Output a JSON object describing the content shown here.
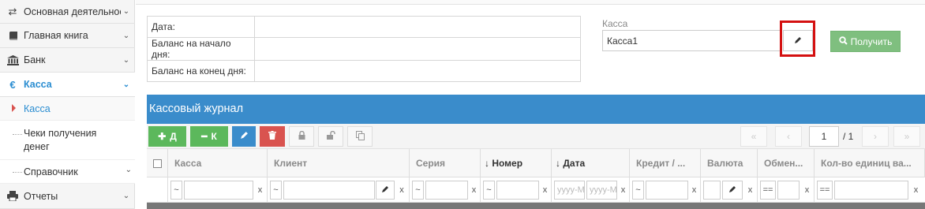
{
  "sidebar": {
    "items": [
      {
        "label": "Основная деятельность",
        "icon": "exchange-icon"
      },
      {
        "label": "Главная книга",
        "icon": "book-icon"
      },
      {
        "label": "Банк",
        "icon": "bank-icon"
      },
      {
        "label": "Касса",
        "icon": "euro-icon"
      },
      {
        "label": "Отчеты",
        "icon": "print-icon"
      }
    ],
    "subitems": [
      {
        "label": "Касса"
      },
      {
        "label": "Чеки получения денег"
      },
      {
        "label": "Справочник"
      }
    ]
  },
  "info": {
    "rows": [
      {
        "label": "Дата:",
        "value": ""
      },
      {
        "label": "Баланс на начало дня:",
        "value": ""
      },
      {
        "label": "Баланс на конец дня:",
        "value": ""
      }
    ]
  },
  "kassa": {
    "label": "Касса",
    "value": "Касса1",
    "get_button": "Получить"
  },
  "journal": {
    "title": "Кассовый журнал",
    "toolbar": {
      "debit_label": "Д",
      "credit_label": "К"
    },
    "pagination": {
      "page": "1",
      "total": "/ 1"
    },
    "columns": [
      {
        "label": "Касса"
      },
      {
        "label": "Клиент"
      },
      {
        "label": "Серия"
      },
      {
        "label": "Номер",
        "sort": "↓"
      },
      {
        "label": "Дата",
        "sort": "↓"
      },
      {
        "label": "Кредит / ..."
      },
      {
        "label": "Валюта"
      },
      {
        "label": "Обмен..."
      },
      {
        "label": "Кол-во единиц ва..."
      }
    ],
    "filters": {
      "approx": "~",
      "equals": "==",
      "clear": "x",
      "date_placeholder": "yyyy-MM-dd"
    }
  }
}
